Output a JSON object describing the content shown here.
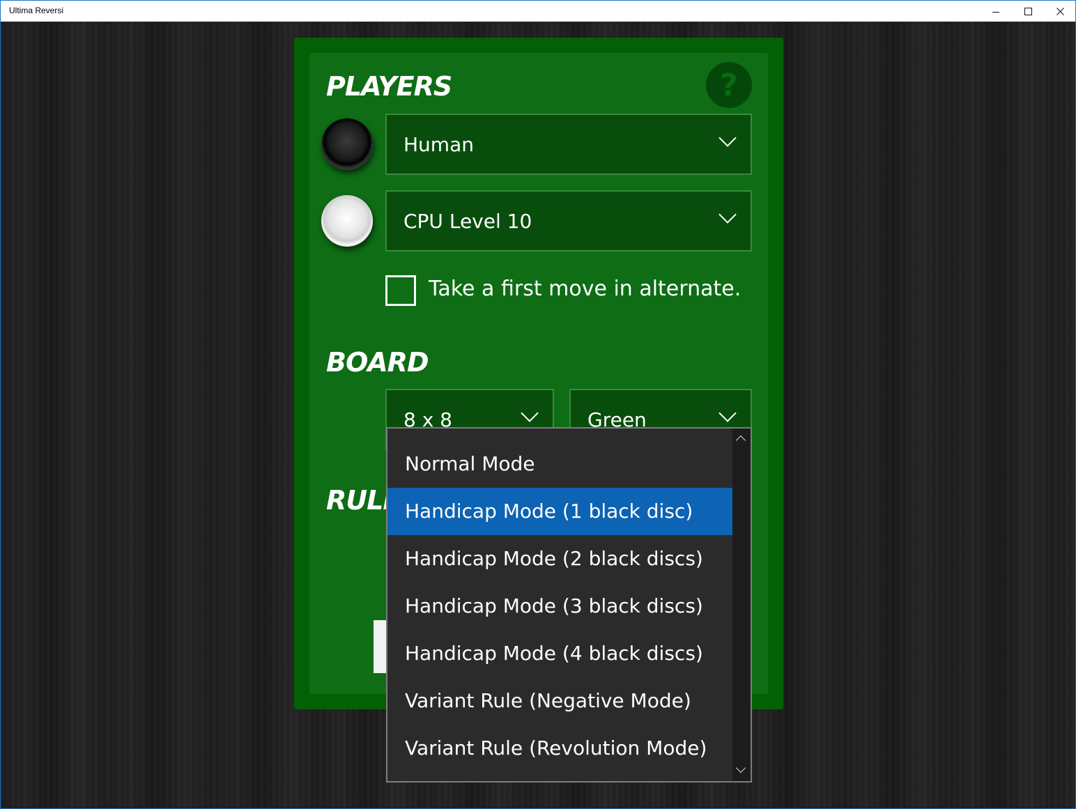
{
  "window": {
    "title": "Ultima Reversi",
    "accent": "#1a73c9"
  },
  "players": {
    "heading": "PLAYERS",
    "help_glyph": "?",
    "black_player": "Human",
    "white_player": "CPU Level 10",
    "alternate_first_move": {
      "label": "Take a first move in alternate.",
      "checked": false
    }
  },
  "board": {
    "heading": "BOARD",
    "size": "8 x 8",
    "color": "Green"
  },
  "rules": {
    "heading_visible": "RULE",
    "options": [
      "Normal Mode",
      "Handicap Mode (1 black disc)",
      "Handicap Mode (2 black discs)",
      "Handicap Mode (3 black discs)",
      "Handicap Mode (4 black discs)",
      "Variant Rule (Negative Mode)",
      "Variant Rule (Revolution Mode)"
    ],
    "selected_option": "Handicap Mode (1 black disc)",
    "selected_color": "#0d63b4"
  },
  "colors": {
    "panel_outer": "#036005",
    "panel_inner": "#0e6d15",
    "combo_bg": "#094d0d",
    "dropdown_bg": "#2b2b2b"
  },
  "icons": [
    "minimize-icon",
    "maximize-icon",
    "close-icon",
    "help-icon",
    "chevron-down-icon",
    "scroll-up-icon",
    "scroll-down-icon"
  ]
}
